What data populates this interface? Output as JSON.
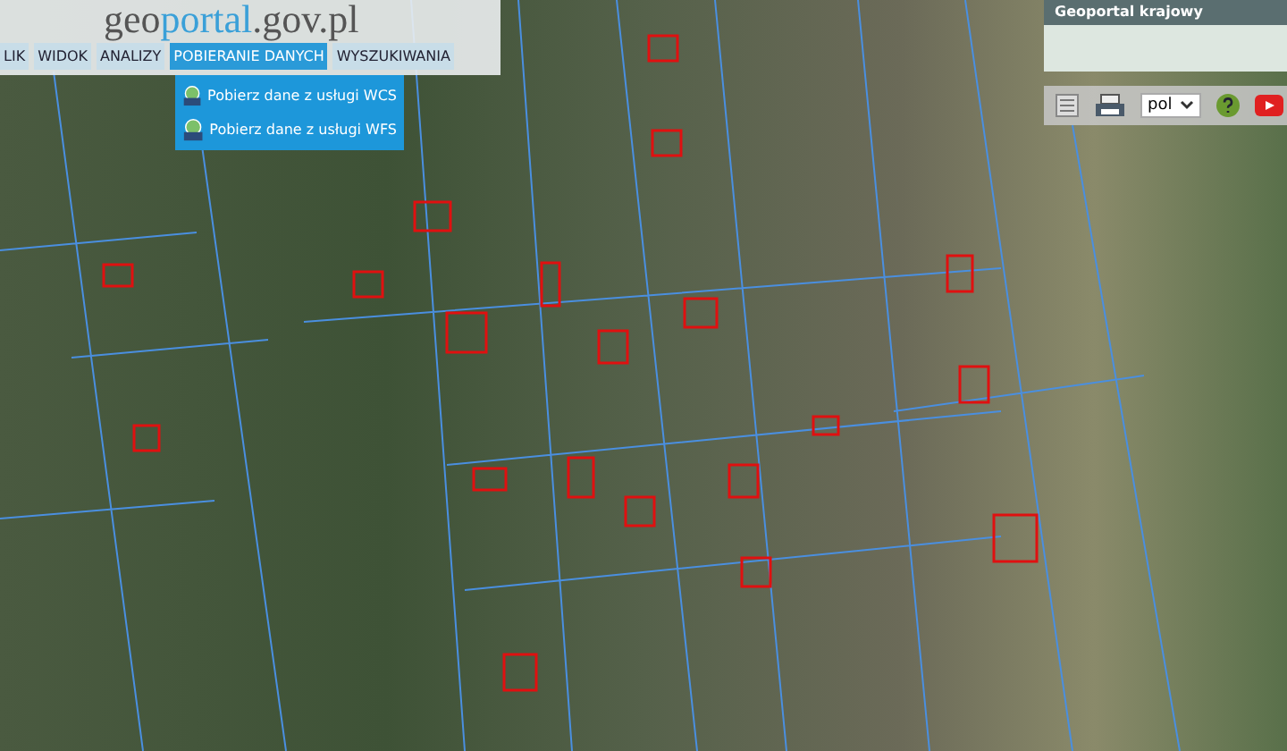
{
  "logo": {
    "prefix": "geo",
    "highlight": "portal",
    "suffix": ".gov.pl"
  },
  "menu": [
    {
      "label": "LIK",
      "selected": false
    },
    {
      "label": "WIDOK",
      "selected": false
    },
    {
      "label": "ANALIZY",
      "selected": false
    },
    {
      "label": "POBIERANIE DANYCH",
      "selected": true
    },
    {
      "label": "WYSZUKIWANIA",
      "selected": false
    }
  ],
  "dropdown": [
    {
      "label": "Pobierz dane z usługi WCS"
    },
    {
      "label": "Pobierz dane z usługi WFS"
    }
  ],
  "overview": {
    "title": "Geoportal krajowy"
  },
  "toolbar": {
    "language": "pol"
  }
}
